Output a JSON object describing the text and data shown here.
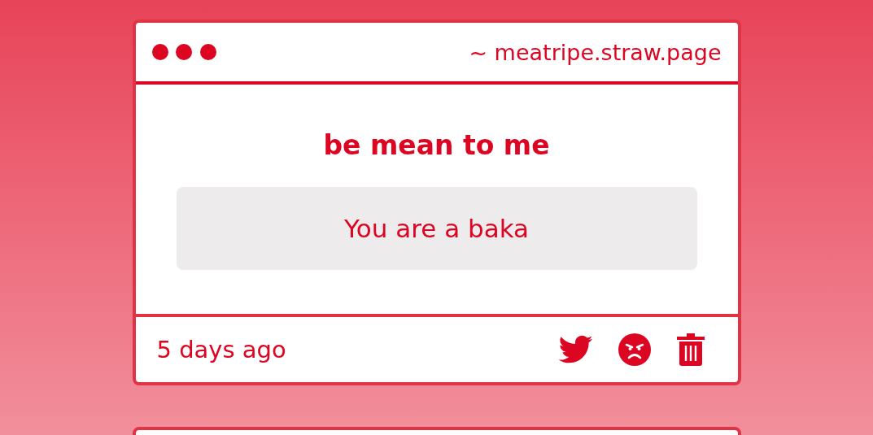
{
  "cards": [
    {
      "address": "~ meatripe.straw.page",
      "question": "be mean to me",
      "answer": "You are a baka",
      "time": "5 days ago"
    }
  ],
  "next_card": {
    "kind": "card"
  }
}
